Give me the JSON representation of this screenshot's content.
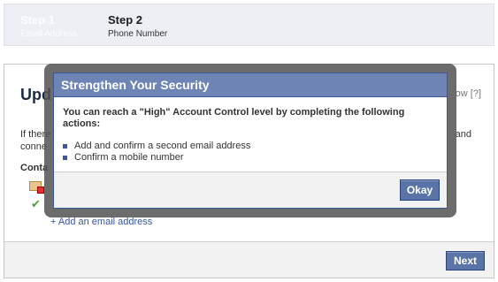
{
  "steps": [
    {
      "title": "Step 1",
      "subtitle": "Email Address"
    },
    {
      "title": "Step 2",
      "subtitle": "Phone Number"
    }
  ],
  "panel": {
    "heading_partial": "Upd",
    "help_partial": "ow",
    "help_q": "[?]",
    "text_line1_start": "If there",
    "text_line1_end": "and",
    "text_line2_start": "conne",
    "contact_label_partial": "Conta",
    "add_email_link": "+ Add an email address",
    "next_button": "Next"
  },
  "dialog": {
    "title": "Strengthen Your Security",
    "lead": "You can reach a \"High\" Account Control level by completing the following actions:",
    "items": [
      "Add and confirm a second email address",
      "Confirm a mobile number"
    ],
    "okay_button": "Okay"
  }
}
